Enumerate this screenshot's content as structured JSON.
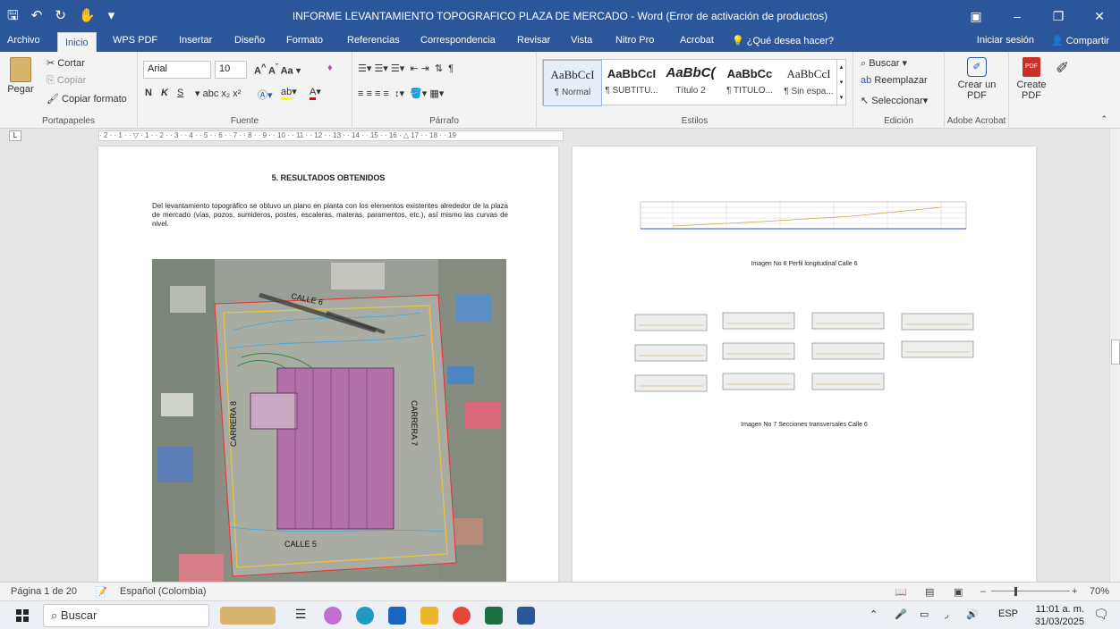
{
  "window": {
    "title": "INFORME LEVANTAMIENTO TOPOGRAFICO PLAZA DE MERCADO - Word (Error de activación de productos)"
  },
  "menu_tabs": [
    "Archivo",
    "Inicio",
    "WPS PDF",
    "Insertar",
    "Diseño",
    "Formato",
    "Referencias",
    "Correspondencia",
    "Revisar",
    "Vista",
    "Nitro Pro",
    "Acrobat"
  ],
  "tell_me": "¿Qué desea hacer?",
  "signin": "Iniciar sesión",
  "share": "Compartir",
  "ribbon": {
    "clipboard": {
      "paste": "Pegar",
      "cut": "Cortar",
      "copy": "Copiar",
      "format_painter": "Copiar formato",
      "label": "Portapapeles"
    },
    "font": {
      "name": "Arial",
      "size": "10",
      "label": "Fuente",
      "bold": "N",
      "italic": "K",
      "underline": "S"
    },
    "paragraph": {
      "label": "Párrafo"
    },
    "styles": {
      "label": "Estilos",
      "items": [
        {
          "preview": "AaBbCcI",
          "name": "¶ Normal"
        },
        {
          "preview": "AaBbCcI",
          "name": "¶ SUBTITU..."
        },
        {
          "preview": "AaBbC(",
          "name": "Título 2"
        },
        {
          "preview": "AaBbCc",
          "name": "¶ TITULO..."
        },
        {
          "preview": "AaBbCcI",
          "name": "¶ Sin espa..."
        }
      ]
    },
    "editing": {
      "find": "Buscar",
      "replace": "Reemplazar",
      "select": "Seleccionar",
      "label": "Edición"
    },
    "acrobat": {
      "create_pdf": "Crear un PDF",
      "label": "Adobe Acrobat"
    },
    "create_pdf2": "Create PDF"
  },
  "document": {
    "page1": {
      "heading": "5. RESULTADOS OBTENIDOS",
      "paragraph": "Del levantamiento topográfico se obtuvo un plano en planta con los elementos existentes alrededor de la plaza de mercado (vías, pozos, sumideros, postes, escaleras, materas, paramentos, etc.), así mismo las curvas de nivel.",
      "map_labels": {
        "calle6": "CALLE 6",
        "calle5": "CALLE 5",
        "carrera8": "CARRERA 8",
        "carrera7": "CARRERA 7"
      }
    },
    "page2": {
      "caption1": "Imagen  No 6 Perfil longitudinal  Calle  6",
      "caption2": "Imagen  No 7 Secciones  transversales  Calle  6"
    }
  },
  "status": {
    "page": "Página 1 de 20",
    "language": "Español (Colombia)",
    "zoom": "70%"
  },
  "taskbar": {
    "search": "Buscar",
    "lang": "ESP",
    "time": "11:01 a. m.",
    "date": "31/03/2025"
  },
  "colors": {
    "word_blue": "#2b579a",
    "ribbon_bg": "#f3f3f3"
  }
}
